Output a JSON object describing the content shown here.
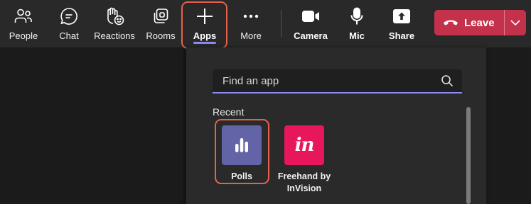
{
  "toolbar": {
    "people": "People",
    "chat": "Chat",
    "reactions": "Reactions",
    "rooms": "Rooms",
    "apps": "Apps",
    "more": "More",
    "camera": "Camera",
    "mic": "Mic",
    "share": "Share",
    "leave": "Leave"
  },
  "apps_panel": {
    "search_placeholder": "Find an app",
    "section_title": "Recent",
    "apps": [
      {
        "name": "Polls"
      },
      {
        "name": "Freehand by InVision",
        "line1": "Freehand by",
        "line2": "InVision",
        "glyph": "in"
      }
    ]
  },
  "colors": {
    "accent": "#8b8cf0",
    "leave_red": "#c4314b",
    "highlight": "#e8604c",
    "polls_tile": "#6264a7",
    "invision_tile": "#e8165a"
  }
}
